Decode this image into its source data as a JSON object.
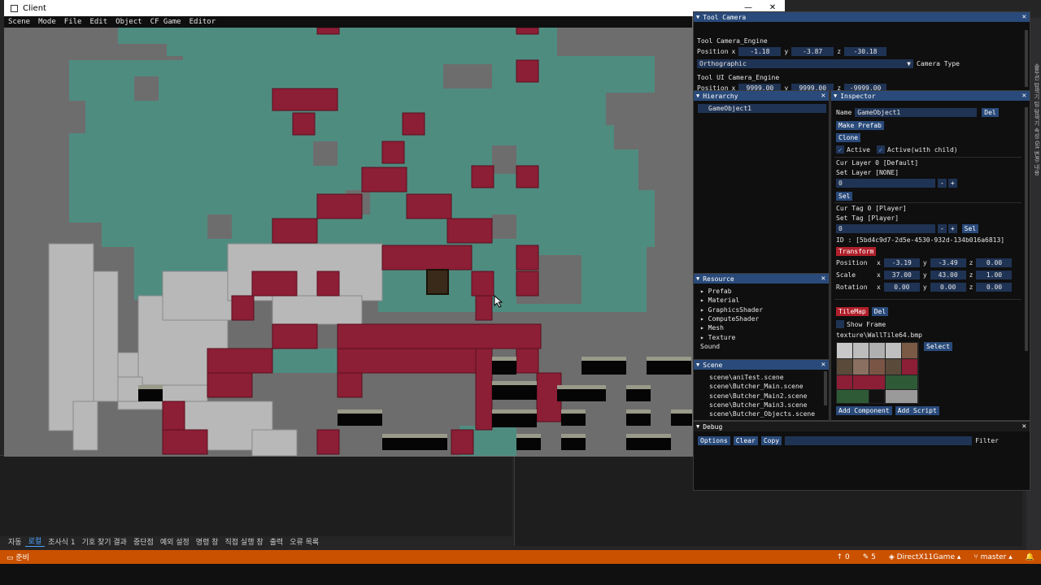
{
  "client": {
    "title": "Client",
    "controls": [
      "—",
      "☐",
      "✕"
    ],
    "menu": [
      "Scene",
      "Mode",
      "File",
      "Edit",
      "Object",
      "CF Game",
      "Editor"
    ]
  },
  "colors": {
    "teal": "#4f8c80",
    "crimson": "#8c1e35",
    "gray": "#6d6d6d",
    "stone": "#b8b8b8",
    "imgui_title": "#294a7a",
    "status": "#ca5100"
  },
  "tool_camera": {
    "title": "Tool Camera",
    "engine_label": "Tool Camera_Engine",
    "position_label": "Position",
    "x_label": "x",
    "x": "-1.18",
    "y_label": "y",
    "y": "-3.87",
    "z_label": "z",
    "z": "-30.18",
    "projection": "Orthographic",
    "camera_type_label": "Camera Type",
    "ui_engine_label": "Tool UI Camera_Engine",
    "ui_position_label": "Position",
    "ui_x": "9999.00",
    "ui_y": "9999.00",
    "ui_z": "-9999.00"
  },
  "hierarchy": {
    "title": "Hierarchy",
    "items": [
      "GameObject1"
    ]
  },
  "inspector": {
    "title": "Inspector",
    "name_label": "Name",
    "name_value": "GameObject1",
    "del_label": "Del",
    "make_prefab": "Make Prefab",
    "clone": "Clone",
    "active": "Active",
    "active_child": "Active(with child)",
    "cur_layer": "Cur Layer 0 [Default]",
    "set_layer": "Set Layer [NONE]",
    "layer_value": "0",
    "minus": "-",
    "plus": "+",
    "sel": "Sel",
    "cur_tag": "Cur Tag 0 [Player]",
    "set_tag": "Set Tag [Player]",
    "tag_value": "0",
    "id": "ID : [5bd4c9d7-2d5e-4530-932d-134b016a6813]",
    "transform_label": "Transform",
    "position_label": "Position",
    "pos_x": "-3.19",
    "pos_y": "-3.49",
    "pos_z": "0.00",
    "scale_label": "Scale",
    "scale_x": "37.00",
    "scale_y": "43.00",
    "scale_z": "1.00",
    "rotation_label": "Rotation",
    "rot_x": "0.00",
    "rot_y": "0.00",
    "rot_z": "0.00",
    "tilemap_label": "TileMap",
    "tilemap_del": "Del",
    "show_frame": "Show Frame",
    "texture_path": "texture\\WallTile64.bmp",
    "select": "Select",
    "add_component": "Add Component",
    "add_script": "Add Script",
    "axis_x": "x",
    "axis_y": "y",
    "axis_z": "z"
  },
  "resource": {
    "title": "Resource",
    "items": [
      "Prefab",
      "Material",
      "GraphicsShader",
      "ComputeShader",
      "Mesh",
      "Texture",
      "Sound"
    ]
  },
  "scene": {
    "title": "Scene",
    "items": [
      "scene\\aniTest.scene",
      "scene\\Butcher_Main.scene",
      "scene\\Butcher_Main2.scene",
      "scene\\Butcher_Main3.scene",
      "scene\\Butcher_Objects.scene"
    ]
  },
  "debug": {
    "title": "Debug",
    "options": "Options",
    "clear": "Clear",
    "copy": "Copy",
    "filter": "Filter"
  },
  "vs": {
    "tabs": [
      "자동",
      "로컬",
      "조사식 1",
      "기호 찾기 결과",
      "중단점",
      "예외 설정",
      "명령 창",
      "직접 실행 창",
      "출력",
      "오류 목록"
    ],
    "selected_tab": "로컬",
    "status_ready": "준비",
    "status_up": "0",
    "status_edit": "5",
    "status_project": "DirectX11Game",
    "status_branch": "master",
    "right_bar": "솔루션 탐색기  팀 탐색기  속성  Git 변경 내용"
  }
}
